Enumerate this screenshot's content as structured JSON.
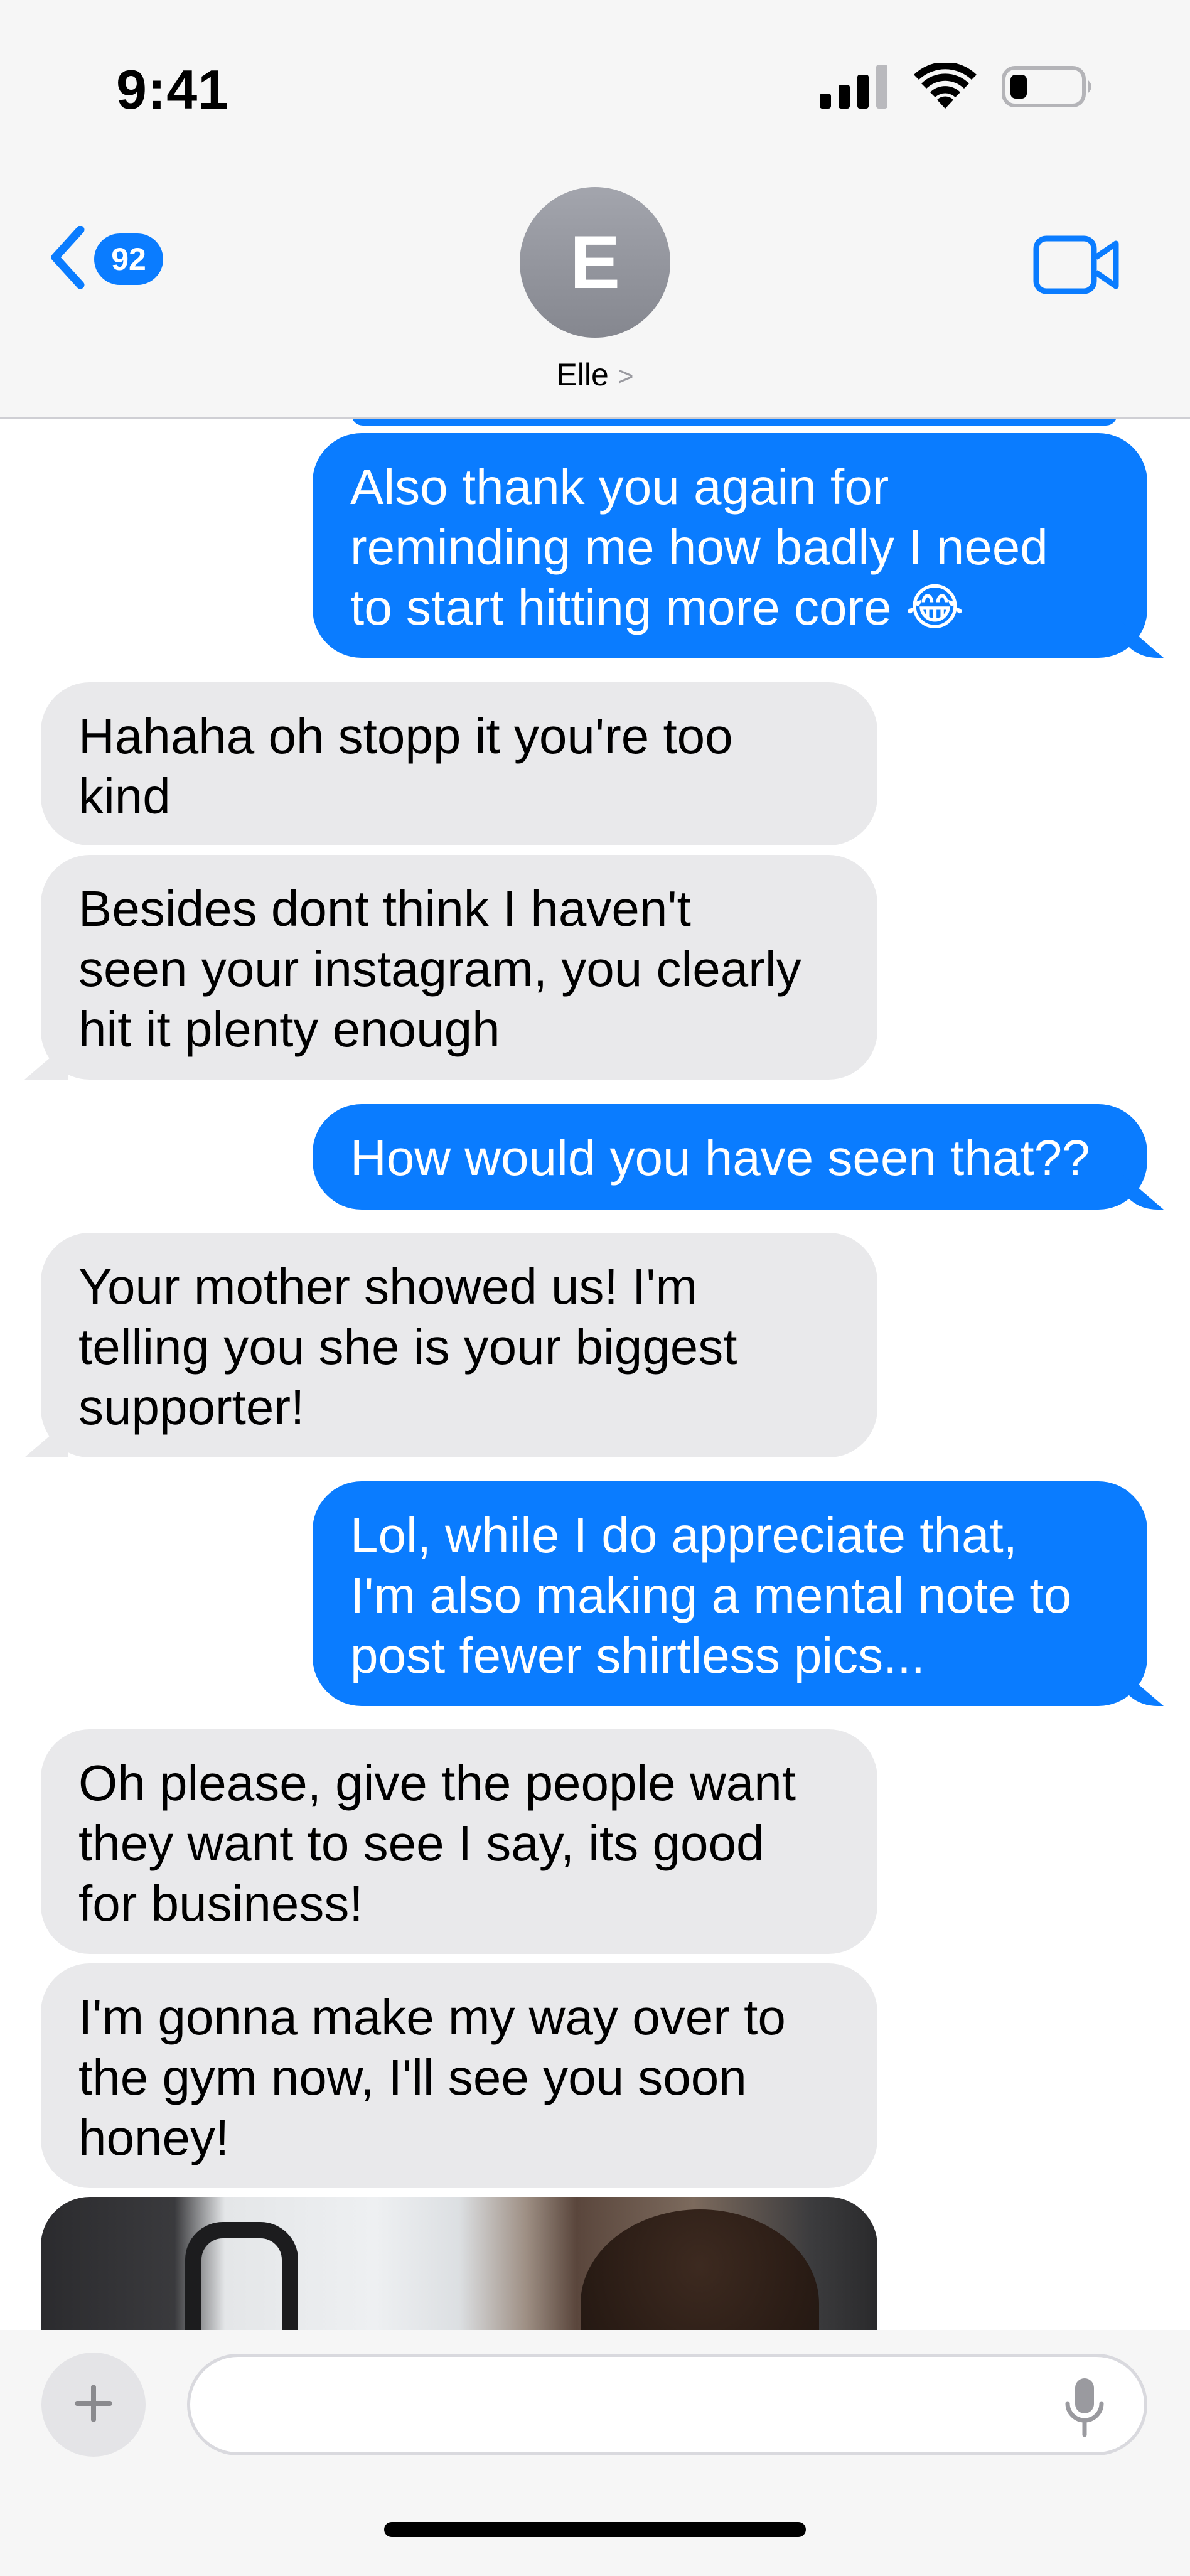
{
  "status_bar": {
    "time": "9:41",
    "battery_level": 0.2
  },
  "nav": {
    "unread_count": "92",
    "avatar_initial": "E",
    "contact_name": "Elle",
    "contact_chevron": ">"
  },
  "messages": [
    {
      "from": "me",
      "text": "Also thank you again for\nreminding me how badly I need\nto start hitting more core 😂"
    },
    {
      "from": "them",
      "text": "Hahaha oh stopp it you're too\nkind"
    },
    {
      "from": "them",
      "text": "Besides dont think I haven't\nseen your instagram, you clearly\nhit it plenty enough"
    },
    {
      "from": "me",
      "text": "How would you have seen that??"
    },
    {
      "from": "them",
      "text": "Your mother showed us! I'm\ntelling you she is your biggest\nsupporter!"
    },
    {
      "from": "me",
      "text": "Lol, while I do appreciate that,\nI'm also making a mental note to\npost fewer shirtless pics..."
    },
    {
      "from": "them",
      "text": "Oh please, give the people want\nthey want to see I say, its good\nfor business!"
    },
    {
      "from": "them",
      "text": "I'm gonna make my way over to\nthe gym now, I'll see you soon\nhoney!"
    }
  ],
  "composer": {
    "placeholder": "",
    "value": ""
  },
  "colors": {
    "outgoing_bubble": "#0a7cff",
    "incoming_bubble": "#e9e9eb",
    "accent": "#0a7cff"
  },
  "icons": {
    "back": "chevron-left-icon",
    "video": "video-camera-icon",
    "plus": "plus-icon",
    "mic": "microphone-icon",
    "signal": "cellular-signal-icon",
    "wifi": "wifi-icon",
    "battery": "battery-icon"
  }
}
